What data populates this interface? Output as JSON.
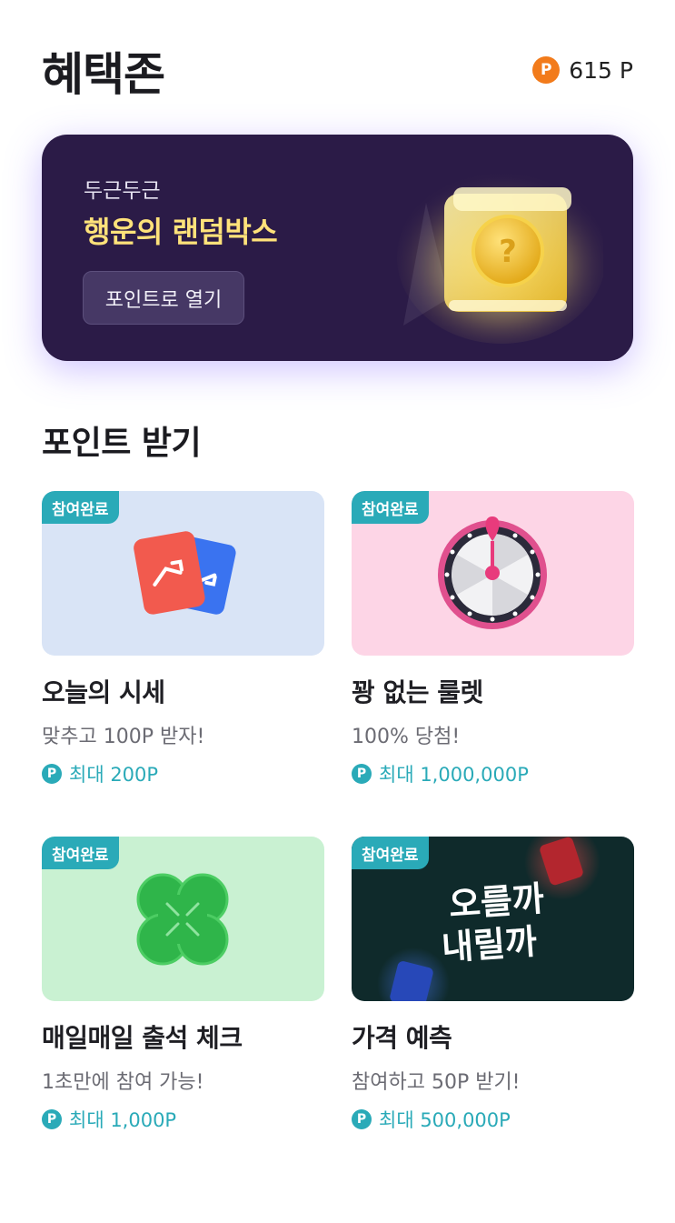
{
  "header": {
    "title": "혜택존",
    "points": "615 P",
    "coin_glyph": "P"
  },
  "banner": {
    "subtitle": "두근두근",
    "title": "행운의 랜덤박스",
    "button_label": "포인트로 열기",
    "icon": "mystery-box-icon"
  },
  "section": {
    "title": "포인트 받기"
  },
  "cards": [
    {
      "badge": "참여완료",
      "title": "오늘의 시세",
      "desc": "맞추고 100P 받자!",
      "reward": "최대 200P",
      "coin": "P",
      "bg": "#d9e4f6",
      "icon": "up-down-cards-icon"
    },
    {
      "badge": "참여완료",
      "title": "꽝 없는 룰렛",
      "desc": "100% 당첨!",
      "reward": "최대 1,000,000P",
      "coin": "P",
      "bg": "#fdd5e6",
      "icon": "roulette-icon"
    },
    {
      "badge": "참여완료",
      "title": "매일매일 출석 체크",
      "desc": "1초만에 참여 가능!",
      "reward": "최대 1,000P",
      "coin": "P",
      "bg": "#c9f1d2",
      "icon": "clover-icon"
    },
    {
      "badge": "참여완료",
      "title": "가격 예측",
      "desc": "참여하고 50P 받기!",
      "reward": "최대 500,000P",
      "coin": "P",
      "bg": "#0f2a2b",
      "icon": "price-prediction-icon",
      "artwork_lines": [
        "오를까",
        "내릴까"
      ]
    }
  ],
  "colors": {
    "accent": "#2aaab8",
    "point_orange": "#f27b1b",
    "banner_bg": "#2b1b47",
    "banner_title": "#ffe27a"
  }
}
